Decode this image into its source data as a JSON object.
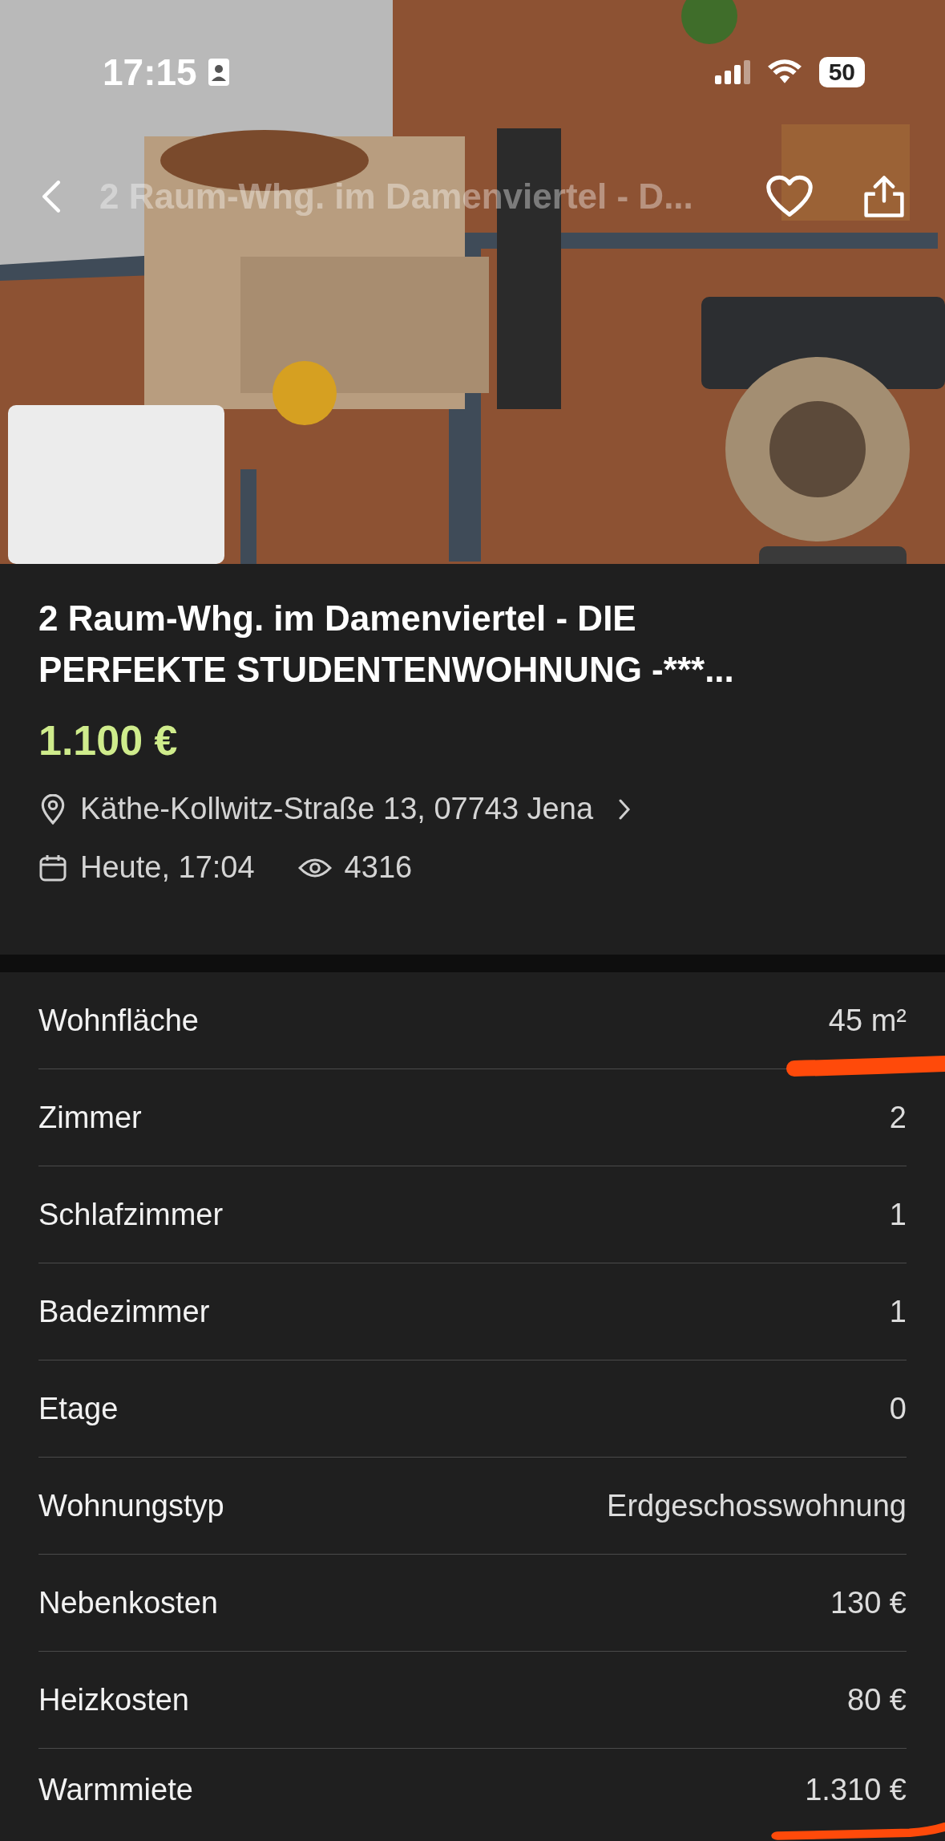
{
  "status_bar": {
    "time": "17:15",
    "battery": "50"
  },
  "nav": {
    "title": "2 Raum-Whg. im Damenviertel - D..."
  },
  "listing": {
    "title": "2 Raum-Whg. im Damenviertel - DIE PERFEKTE STUDENTENWOHNUNG -***...",
    "price": "1.100 €",
    "address": "Käthe-Kollwitz-Straße 13, 07743 Jena",
    "posted": "Heute, 17:04",
    "views": "4316"
  },
  "details": [
    {
      "label": "Wohnfläche",
      "value": "45 m²",
      "annotated": true
    },
    {
      "label": "Zimmer",
      "value": "2",
      "annotated": false
    },
    {
      "label": "Schlafzimmer",
      "value": "1",
      "annotated": false
    },
    {
      "label": "Badezimmer",
      "value": "1",
      "annotated": false
    },
    {
      "label": "Etage",
      "value": "0",
      "annotated": false
    },
    {
      "label": "Wohnungstyp",
      "value": "Erdgeschosswohnung",
      "annotated": false
    },
    {
      "label": "Nebenkosten",
      "value": "130 €",
      "annotated": false
    },
    {
      "label": "Heizkosten",
      "value": "80 €",
      "annotated": false
    },
    {
      "label": "Warmmiete",
      "value": "1.310 €",
      "annotated": true
    }
  ]
}
